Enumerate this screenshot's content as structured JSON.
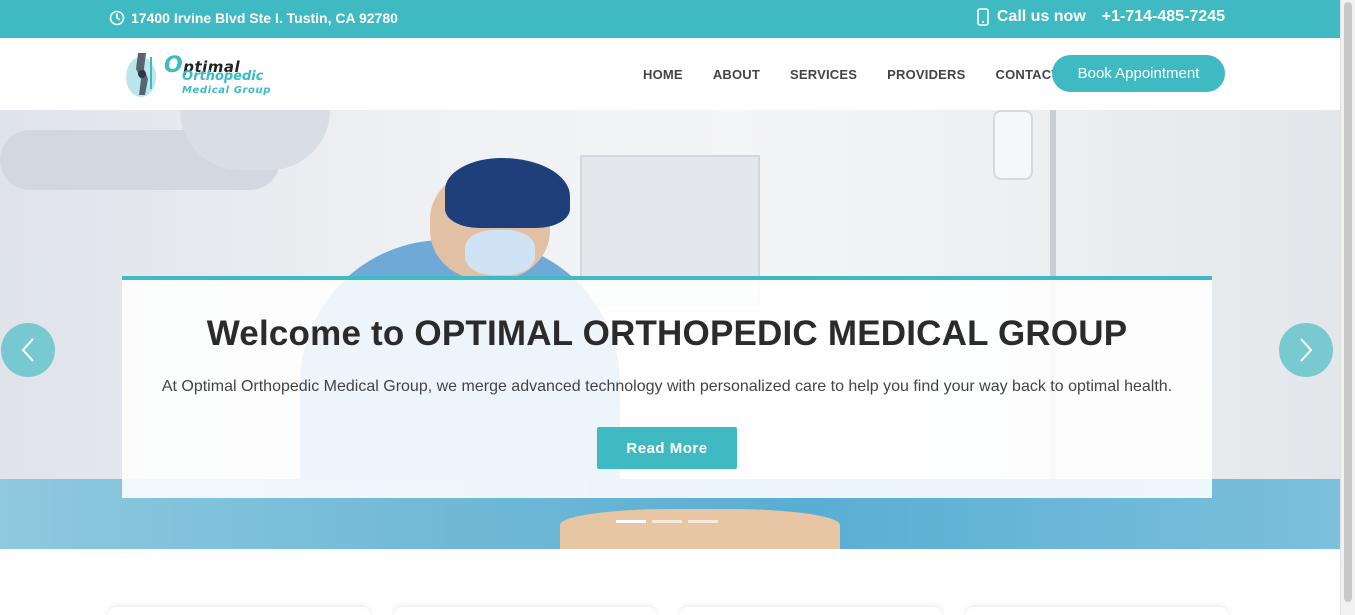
{
  "topbar": {
    "address": "17400 Irvine Blvd Ste I. Tustin, CA 92780",
    "call_label": "Call us now",
    "phone": "+1-714-485-7245"
  },
  "logo": {
    "line1_initial": "O",
    "line1_rest": "ptimal",
    "line2_initial": "O",
    "line2_rest": "rthopedic",
    "line3": "Medical Group"
  },
  "nav": {
    "items": [
      {
        "label": "HOME"
      },
      {
        "label": "ABOUT"
      },
      {
        "label": "SERVICES"
      },
      {
        "label": "PROVIDERS"
      },
      {
        "label": "CONTACT"
      }
    ],
    "book_label": "Book Appointment"
  },
  "hero": {
    "title": "Welcome to OPTIMAL ORTHOPEDIC MEDICAL GROUP",
    "description": "At Optimal Orthopedic Medical Group, we merge advanced technology with personalized care to help you find your way back to optimal health.",
    "cta_label": "Read More",
    "slide_count": 3,
    "active_slide": 1
  },
  "colors": {
    "accent": "#3fbac2",
    "text_dark": "#2b2b2b",
    "nav_text": "#444444"
  },
  "icons": {
    "address": "clock-icon",
    "phone": "mobile-phone-icon",
    "prev": "chevron-left-icon",
    "next": "chevron-right-icon"
  }
}
